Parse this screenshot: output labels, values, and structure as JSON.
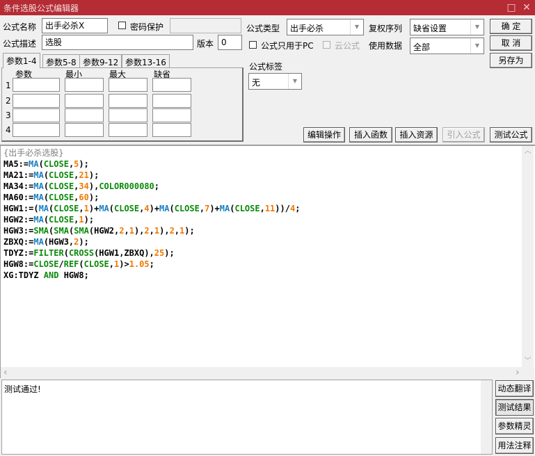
{
  "window": {
    "title": "条件选股公式编辑器",
    "maximize_icon": "□",
    "close_icon": "✕",
    "title_bar_color": "#b52c35"
  },
  "form": {
    "name_label": "公式名称",
    "name_value": "出手必杀X",
    "password_label": "密码保护",
    "password_checked": false,
    "password_value": "",
    "desc_label": "公式描述",
    "desc_value": "选股",
    "version_label": "版本",
    "version_value": "0",
    "type_label": "公式类型",
    "type_value": "出手必杀",
    "restore_label": "复权序列",
    "restore_value": "缺省设置",
    "pc_only_label": "公式只用于PC",
    "pc_only_checked": false,
    "cloud_label": "云公式",
    "cloud_checked": false,
    "data_label": "使用数据",
    "data_value": "全部",
    "tag_label": "公式标签",
    "tag_value": "无"
  },
  "actions": {
    "ok": "确  定",
    "cancel": "取  消",
    "save_as": "另存为"
  },
  "params": {
    "tabs": [
      "参数1-4",
      "参数5-8",
      "参数9-12",
      "参数13-16"
    ],
    "active_tab": 0,
    "headers": [
      "参数",
      "最小",
      "最大",
      "缺省"
    ],
    "rows": [
      {
        "index": "1",
        "name": "",
        "min": "",
        "max": "",
        "default": ""
      },
      {
        "index": "2",
        "name": "",
        "min": "",
        "max": "",
        "default": ""
      },
      {
        "index": "3",
        "name": "",
        "min": "",
        "max": "",
        "default": ""
      },
      {
        "index": "4",
        "name": "",
        "min": "",
        "max": "",
        "default": ""
      }
    ]
  },
  "toolbar": {
    "edit_ops": "编辑操作",
    "insert_func": "插入函数",
    "insert_res": "插入资源",
    "import_formula": "引入公式",
    "test_formula": "测试公式"
  },
  "code_colors": {
    "plain": "#000000",
    "function": "#1a7fc0",
    "keyword": "#0a8a0a",
    "number": "#f07800",
    "comment": "#808080"
  },
  "code_lines": [
    [
      {
        "t": "{出手必杀选股}",
        "c": "comment"
      }
    ],
    [
      {
        "t": "MA5:=",
        "c": "plain"
      },
      {
        "t": "MA",
        "c": "function"
      },
      {
        "t": "(",
        "c": "plain"
      },
      {
        "t": "CLOSE",
        "c": "keyword"
      },
      {
        "t": ",",
        "c": "plain"
      },
      {
        "t": "5",
        "c": "number"
      },
      {
        "t": ");",
        "c": "plain"
      }
    ],
    [
      {
        "t": "MA21:=",
        "c": "plain"
      },
      {
        "t": "MA",
        "c": "function"
      },
      {
        "t": "(",
        "c": "plain"
      },
      {
        "t": "CLOSE",
        "c": "keyword"
      },
      {
        "t": ",",
        "c": "plain"
      },
      {
        "t": "21",
        "c": "number"
      },
      {
        "t": ");",
        "c": "plain"
      }
    ],
    [
      {
        "t": "MA34:=",
        "c": "plain"
      },
      {
        "t": "MA",
        "c": "function"
      },
      {
        "t": "(",
        "c": "plain"
      },
      {
        "t": "CLOSE",
        "c": "keyword"
      },
      {
        "t": ",",
        "c": "plain"
      },
      {
        "t": "34",
        "c": "number"
      },
      {
        "t": "),",
        "c": "plain"
      },
      {
        "t": "COLOR000080",
        "c": "keyword"
      },
      {
        "t": ";",
        "c": "plain"
      }
    ],
    [
      {
        "t": "MA60:=",
        "c": "plain"
      },
      {
        "t": "MA",
        "c": "function"
      },
      {
        "t": "(",
        "c": "plain"
      },
      {
        "t": "CLOSE",
        "c": "keyword"
      },
      {
        "t": ",",
        "c": "plain"
      },
      {
        "t": "60",
        "c": "number"
      },
      {
        "t": ");",
        "c": "plain"
      }
    ],
    [
      {
        "t": "HGW1:=(",
        "c": "plain"
      },
      {
        "t": "MA",
        "c": "function"
      },
      {
        "t": "(",
        "c": "plain"
      },
      {
        "t": "CLOSE",
        "c": "keyword"
      },
      {
        "t": ",",
        "c": "plain"
      },
      {
        "t": "1",
        "c": "number"
      },
      {
        "t": ")+",
        "c": "plain"
      },
      {
        "t": "MA",
        "c": "function"
      },
      {
        "t": "(",
        "c": "plain"
      },
      {
        "t": "CLOSE",
        "c": "keyword"
      },
      {
        "t": ",",
        "c": "plain"
      },
      {
        "t": "4",
        "c": "number"
      },
      {
        "t": ")+",
        "c": "plain"
      },
      {
        "t": "MA",
        "c": "function"
      },
      {
        "t": "(",
        "c": "plain"
      },
      {
        "t": "CLOSE",
        "c": "keyword"
      },
      {
        "t": ",",
        "c": "plain"
      },
      {
        "t": "7",
        "c": "number"
      },
      {
        "t": ")+",
        "c": "plain"
      },
      {
        "t": "MA",
        "c": "function"
      },
      {
        "t": "(",
        "c": "plain"
      },
      {
        "t": "CLOSE",
        "c": "keyword"
      },
      {
        "t": ",",
        "c": "plain"
      },
      {
        "t": "11",
        "c": "number"
      },
      {
        "t": "))/",
        "c": "plain"
      },
      {
        "t": "4",
        "c": "number"
      },
      {
        "t": ";",
        "c": "plain"
      }
    ],
    [
      {
        "t": "HGW2:=",
        "c": "plain"
      },
      {
        "t": "MA",
        "c": "function"
      },
      {
        "t": "(",
        "c": "plain"
      },
      {
        "t": "CLOSE",
        "c": "keyword"
      },
      {
        "t": ",",
        "c": "plain"
      },
      {
        "t": "1",
        "c": "number"
      },
      {
        "t": ");",
        "c": "plain"
      }
    ],
    [
      {
        "t": "HGW3:=",
        "c": "plain"
      },
      {
        "t": "SMA",
        "c": "keyword"
      },
      {
        "t": "(",
        "c": "plain"
      },
      {
        "t": "SMA",
        "c": "keyword"
      },
      {
        "t": "(",
        "c": "plain"
      },
      {
        "t": "SMA",
        "c": "keyword"
      },
      {
        "t": "(HGW2,",
        "c": "plain"
      },
      {
        "t": "2",
        "c": "number"
      },
      {
        "t": ",",
        "c": "plain"
      },
      {
        "t": "1",
        "c": "number"
      },
      {
        "t": "),",
        "c": "plain"
      },
      {
        "t": "2",
        "c": "number"
      },
      {
        "t": ",",
        "c": "plain"
      },
      {
        "t": "1",
        "c": "number"
      },
      {
        "t": "),",
        "c": "plain"
      },
      {
        "t": "2",
        "c": "number"
      },
      {
        "t": ",",
        "c": "plain"
      },
      {
        "t": "1",
        "c": "number"
      },
      {
        "t": ");",
        "c": "plain"
      }
    ],
    [
      {
        "t": "ZBXQ:=",
        "c": "plain"
      },
      {
        "t": "MA",
        "c": "function"
      },
      {
        "t": "(HGW3,",
        "c": "plain"
      },
      {
        "t": "2",
        "c": "number"
      },
      {
        "t": ");",
        "c": "plain"
      }
    ],
    [
      {
        "t": "TDYZ:=",
        "c": "plain"
      },
      {
        "t": "FILTER",
        "c": "keyword"
      },
      {
        "t": "(",
        "c": "plain"
      },
      {
        "t": "CROSS",
        "c": "keyword"
      },
      {
        "t": "(HGW1,ZBXQ),",
        "c": "plain"
      },
      {
        "t": "25",
        "c": "number"
      },
      {
        "t": ");",
        "c": "plain"
      }
    ],
    [
      {
        "t": "HGW8:=",
        "c": "plain"
      },
      {
        "t": "CLOSE",
        "c": "keyword"
      },
      {
        "t": "/",
        "c": "plain"
      },
      {
        "t": "REF",
        "c": "keyword"
      },
      {
        "t": "(",
        "c": "plain"
      },
      {
        "t": "CLOSE",
        "c": "keyword"
      },
      {
        "t": ",",
        "c": "plain"
      },
      {
        "t": "1",
        "c": "number"
      },
      {
        "t": ")>",
        "c": "plain"
      },
      {
        "t": "1.05",
        "c": "number"
      },
      {
        "t": ";",
        "c": "plain"
      }
    ],
    [
      {
        "t": "XG:TDYZ ",
        "c": "plain"
      },
      {
        "t": "AND",
        "c": "keyword"
      },
      {
        "t": " HGW8;",
        "c": "plain"
      }
    ]
  ],
  "scroll": {
    "up": "︿",
    "down": "﹀",
    "left": "‹",
    "right": "›"
  },
  "result": {
    "text": "测试通过!"
  },
  "side_buttons": [
    {
      "label": "动态翻译",
      "active": false
    },
    {
      "label": "测试结果",
      "active": true
    },
    {
      "label": "参数精灵",
      "active": false
    },
    {
      "label": "用法注释",
      "active": false
    }
  ]
}
